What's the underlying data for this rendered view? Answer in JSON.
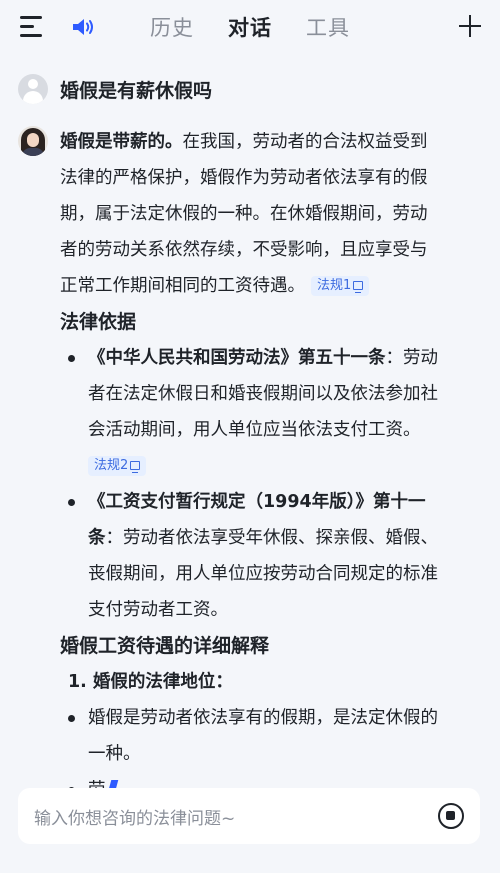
{
  "header": {
    "tabs": [
      {
        "label": "历史"
      },
      {
        "label": "对话"
      },
      {
        "label": "工具"
      }
    ],
    "active_tab": "对话"
  },
  "question": "婚假是有薪休假吗",
  "answer": {
    "intro_bold": "婚假是带薪的。",
    "intro_lines": [
      "在我国，劳动者的合法权益受到",
      "法律的严格保护，婚假作为劳动者依法享有的假",
      "期，属于法定休假的一种。在休婚假期间，劳动",
      "者的劳动关系依然存续，不受影响，且应享受与",
      "正常工作期间相同的工资待遇。"
    ],
    "cite1": "法规1",
    "section1_title": "法律依据",
    "law1": {
      "bold": "《中华人民共和国劳动法》第五十一条",
      "lines": [
        "：劳动",
        "者在法定休假日和婚丧假期间以及依法参加社",
        "会活动期间，用人单位应当依法支付工资。"
      ],
      "cite": "法规2"
    },
    "law2": {
      "bold_lines": [
        "《工资支付暂行规定（1994年版）》第十一",
        "条"
      ],
      "lines": [
        "：劳动者依法享受年休假、探亲假、婚假、",
        "丧假期间，用人单位应按劳动合同规定的标准",
        "支付劳动者工资。"
      ]
    },
    "section2_title": "婚假工资待遇的详细解释",
    "point1_title": "1. 婚假的法律地位：",
    "point1_lines": [
      "婚假是劳动者依法享有的假期，是法定休假的",
      "一种。"
    ],
    "partial": "劳"
  },
  "input": {
    "placeholder": "输入你想咨询的法律问题~"
  },
  "colors": {
    "accent": "#2e5bff",
    "cite_bg": "#e6efff",
    "background": "#f4f6fa"
  }
}
